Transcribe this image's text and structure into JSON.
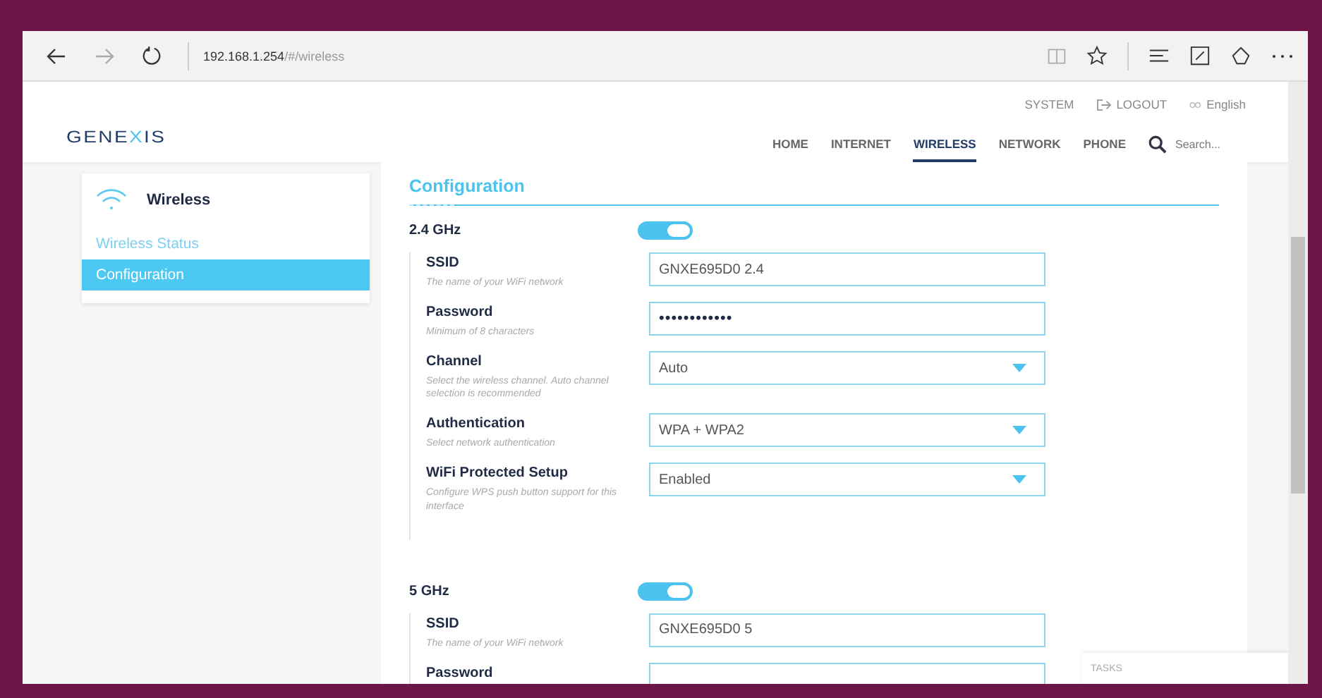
{
  "browser": {
    "url_host": "192.168.1.254",
    "url_path": "/#/wireless"
  },
  "header": {
    "logo": [
      {
        "text": "GENE",
        "accent": false
      },
      {
        "text": "X",
        "accent": true
      },
      {
        "text": "IS",
        "accent": false
      }
    ],
    "top_links": [
      {
        "label": "SYSTEM",
        "kind": "plain"
      },
      {
        "label": "LOGOUT",
        "kind": "logout"
      },
      {
        "label": "English",
        "kind": "language"
      }
    ],
    "nav": [
      {
        "label": "HOME",
        "selected": false
      },
      {
        "label": "INTERNET",
        "selected": false
      },
      {
        "label": "WIRELESS",
        "selected": true
      },
      {
        "label": "NETWORK",
        "selected": false
      },
      {
        "label": "PHONE",
        "selected": false
      }
    ],
    "search": {
      "placeholder": "Search..."
    }
  },
  "sidebar": {
    "title": "Wireless",
    "items": [
      {
        "label": "Wireless Status",
        "selected": false
      },
      {
        "label": "Configuration",
        "selected": true
      }
    ]
  },
  "main": {
    "title": "Configuration",
    "bands": [
      {
        "name": "2.4 GHz",
        "on": true,
        "fields": [
          {
            "kind": "text",
            "label": "SSID",
            "hint": "The name of your WiFi network",
            "value": "GNXE695D0 2.4"
          },
          {
            "kind": "password",
            "label": "Password",
            "hint": "Minimum of 8 characters",
            "value": "••••••••••••"
          },
          {
            "kind": "select",
            "label": "Channel",
            "hint": "Select the wireless channel. Auto channel selection is recommended",
            "value": "Auto"
          },
          {
            "kind": "select",
            "label": "Authentication",
            "hint": "Select network authentication",
            "value": "WPA + WPA2"
          },
          {
            "kind": "select",
            "label": "WiFi Protected Setup",
            "hint": "Configure WPS push button support for this interface",
            "value": "Enabled"
          }
        ]
      },
      {
        "name": "5 GHz",
        "on": true,
        "fields": [
          {
            "kind": "text",
            "label": "SSID",
            "hint": "The name of your WiFi network",
            "value": "GNXE695D0 5"
          },
          {
            "kind": "password",
            "label": "Password"
          }
        ]
      }
    ]
  },
  "tasks": {
    "label": "TASKS"
  }
}
